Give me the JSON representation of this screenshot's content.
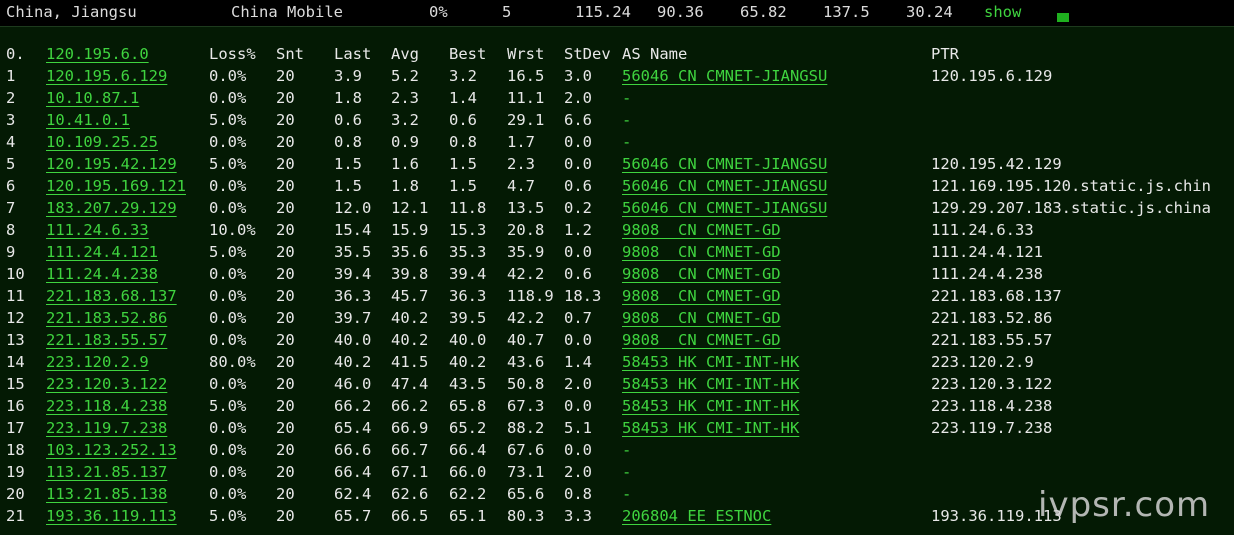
{
  "top": {
    "location": "China, Jiangsu",
    "isp": "China Mobile",
    "loss": "0%",
    "count": "5",
    "v1": "115.24",
    "v2": "90.36",
    "v3": "65.82",
    "v4": "137.5",
    "v5": "30.24",
    "show_label": "show"
  },
  "columns": [
    "0.",
    "120.195.6.0",
    "Loss%",
    "Snt",
    "Last",
    "Avg",
    "Best",
    "Wrst",
    "StDev",
    "AS Name",
    "PTR"
  ],
  "hops": [
    {
      "n": "1",
      "host": "120.195.6.129",
      "loss": "0.0%",
      "snt": "20",
      "last": "3.9",
      "avg": "5.2",
      "best": "3.2",
      "wrst": "16.5",
      "stdev": "3.0",
      "as": "56046 CN CMNET-JIANGSU",
      "ptr": "120.195.6.129"
    },
    {
      "n": "2",
      "host": "10.10.87.1",
      "loss": "0.0%",
      "snt": "20",
      "last": "1.8",
      "avg": "2.3",
      "best": "1.4",
      "wrst": "11.1",
      "stdev": "2.0",
      "as": "-",
      "ptr": ""
    },
    {
      "n": "3",
      "host": "10.41.0.1",
      "loss": "5.0%",
      "snt": "20",
      "last": "0.6",
      "avg": "3.2",
      "best": "0.6",
      "wrst": "29.1",
      "stdev": "6.6",
      "as": "-",
      "ptr": ""
    },
    {
      "n": "4",
      "host": "10.109.25.25",
      "loss": "0.0%",
      "snt": "20",
      "last": "0.8",
      "avg": "0.9",
      "best": "0.8",
      "wrst": "1.7",
      "stdev": "0.0",
      "as": "-",
      "ptr": ""
    },
    {
      "n": "5",
      "host": "120.195.42.129",
      "loss": "5.0%",
      "snt": "20",
      "last": "1.5",
      "avg": "1.6",
      "best": "1.5",
      "wrst": "2.3",
      "stdev": "0.0",
      "as": "56046 CN CMNET-JIANGSU",
      "ptr": "120.195.42.129"
    },
    {
      "n": "6",
      "host": "120.195.169.121",
      "loss": "0.0%",
      "snt": "20",
      "last": "1.5",
      "avg": "1.8",
      "best": "1.5",
      "wrst": "4.7",
      "stdev": "0.6",
      "as": "56046 CN CMNET-JIANGSU",
      "ptr": "121.169.195.120.static.js.chin"
    },
    {
      "n": "7",
      "host": "183.207.29.129",
      "loss": "0.0%",
      "snt": "20",
      "last": "12.0",
      "avg": "12.1",
      "best": "11.8",
      "wrst": "13.5",
      "stdev": "0.2",
      "as": "56046 CN CMNET-JIANGSU",
      "ptr": "129.29.207.183.static.js.china"
    },
    {
      "n": "8",
      "host": "111.24.6.33",
      "loss": "10.0%",
      "snt": "20",
      "last": "15.4",
      "avg": "15.9",
      "best": "15.3",
      "wrst": "20.8",
      "stdev": "1.2",
      "as": "9808  CN CMNET-GD",
      "ptr": "111.24.6.33"
    },
    {
      "n": "9",
      "host": "111.24.4.121",
      "loss": "5.0%",
      "snt": "20",
      "last": "35.5",
      "avg": "35.6",
      "best": "35.3",
      "wrst": "35.9",
      "stdev": "0.0",
      "as": "9808  CN CMNET-GD",
      "ptr": "111.24.4.121"
    },
    {
      "n": "10",
      "host": "111.24.4.238",
      "loss": "0.0%",
      "snt": "20",
      "last": "39.4",
      "avg": "39.8",
      "best": "39.4",
      "wrst": "42.2",
      "stdev": "0.6",
      "as": "9808  CN CMNET-GD",
      "ptr": "111.24.4.238"
    },
    {
      "n": "11",
      "host": "221.183.68.137",
      "loss": "0.0%",
      "snt": "20",
      "last": "36.3",
      "avg": "45.7",
      "best": "36.3",
      "wrst": "118.9",
      "stdev": "18.3",
      "as": "9808  CN CMNET-GD",
      "ptr": "221.183.68.137"
    },
    {
      "n": "12",
      "host": "221.183.52.86",
      "loss": "0.0%",
      "snt": "20",
      "last": "39.7",
      "avg": "40.2",
      "best": "39.5",
      "wrst": "42.2",
      "stdev": "0.7",
      "as": "9808  CN CMNET-GD",
      "ptr": "221.183.52.86"
    },
    {
      "n": "13",
      "host": "221.183.55.57",
      "loss": "0.0%",
      "snt": "20",
      "last": "40.0",
      "avg": "40.2",
      "best": "40.0",
      "wrst": "40.7",
      "stdev": "0.0",
      "as": "9808  CN CMNET-GD",
      "ptr": "221.183.55.57"
    },
    {
      "n": "14",
      "host": "223.120.2.9",
      "loss": "80.0%",
      "snt": "20",
      "last": "40.2",
      "avg": "41.5",
      "best": "40.2",
      "wrst": "43.6",
      "stdev": "1.4",
      "as": "58453 HK CMI-INT-HK",
      "ptr": "223.120.2.9"
    },
    {
      "n": "15",
      "host": "223.120.3.122",
      "loss": "0.0%",
      "snt": "20",
      "last": "46.0",
      "avg": "47.4",
      "best": "43.5",
      "wrst": "50.8",
      "stdev": "2.0",
      "as": "58453 HK CMI-INT-HK",
      "ptr": "223.120.3.122"
    },
    {
      "n": "16",
      "host": "223.118.4.238",
      "loss": "5.0%",
      "snt": "20",
      "last": "66.2",
      "avg": "66.2",
      "best": "65.8",
      "wrst": "67.3",
      "stdev": "0.0",
      "as": "58453 HK CMI-INT-HK",
      "ptr": "223.118.4.238"
    },
    {
      "n": "17",
      "host": "223.119.7.238",
      "loss": "0.0%",
      "snt": "20",
      "last": "65.4",
      "avg": "66.9",
      "best": "65.2",
      "wrst": "88.2",
      "stdev": "5.1",
      "as": "58453 HK CMI-INT-HK",
      "ptr": "223.119.7.238"
    },
    {
      "n": "18",
      "host": "103.123.252.13",
      "loss": "0.0%",
      "snt": "20",
      "last": "66.6",
      "avg": "66.7",
      "best": "66.4",
      "wrst": "67.6",
      "stdev": "0.0",
      "as": "-",
      "ptr": ""
    },
    {
      "n": "19",
      "host": "113.21.85.137",
      "loss": "0.0%",
      "snt": "20",
      "last": "66.4",
      "avg": "67.1",
      "best": "66.0",
      "wrst": "73.1",
      "stdev": "2.0",
      "as": "-",
      "ptr": ""
    },
    {
      "n": "20",
      "host": "113.21.85.138",
      "loss": "0.0%",
      "snt": "20",
      "last": "62.4",
      "avg": "62.6",
      "best": "62.2",
      "wrst": "65.6",
      "stdev": "0.8",
      "as": "-",
      "ptr": ""
    },
    {
      "n": "21",
      "host": "193.36.119.113",
      "loss": "5.0%",
      "snt": "20",
      "last": "65.7",
      "avg": "66.5",
      "best": "65.1",
      "wrst": "80.3",
      "stdev": "3.3",
      "as": "206804 EE ESTNOC",
      "ptr": "193.36.119.113"
    }
  ],
  "watermark": "ivpsr.com"
}
